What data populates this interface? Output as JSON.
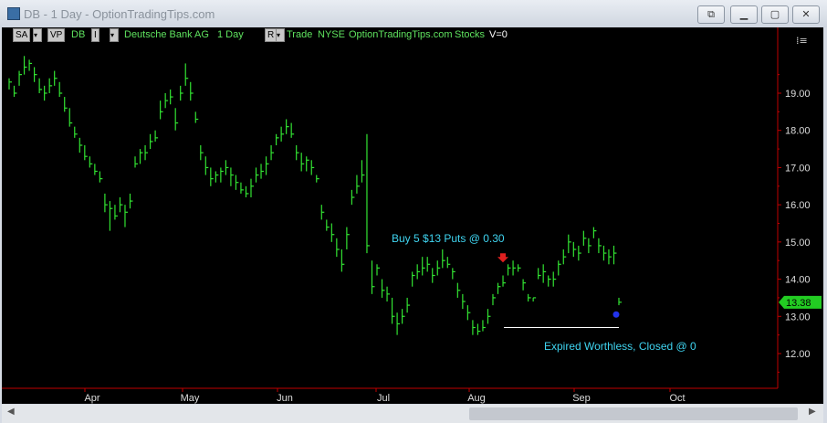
{
  "window": {
    "title": "DB - 1 Day - OptionTradingTips.com"
  },
  "toolbar": {
    "sa_label": "SA",
    "vp_label": "VP",
    "symbol": "DB",
    "i_label": "I",
    "company": "Deutsche Bank AG",
    "period": "1 Day",
    "r_label": "R",
    "trade": "Trade",
    "exchange": "NYSE",
    "site": "OptionTradingTips.com",
    "category": "Stocks",
    "volume": "V=0"
  },
  "colors": {
    "bars": "#32e332",
    "axis": "#c00000",
    "annotation": "#3fd4f0",
    "price_tag": "#22cc22",
    "buy_marker": "#e02020",
    "exit_marker": "#2233ee"
  },
  "chart_data": {
    "type": "ohlc",
    "title": "",
    "xlabel": "",
    "ylabel": "",
    "ylim": [
      11.0,
      20.0
    ],
    "y_ticks": [
      "12.00",
      "13.00",
      "14.00",
      "15.00",
      "16.00",
      "17.00",
      "18.00",
      "19.00"
    ],
    "x_ticks": [
      "Apr",
      "May",
      "Jun",
      "Jul",
      "Aug",
      "Sep",
      "Oct"
    ],
    "last_price": "13.38",
    "annotations": [
      "Buy 5 $13 Puts @ 0.30",
      "Expired Worthless, Closed @ 0"
    ],
    "buy_marker_price": 14.45,
    "exit_marker_price": 13.05,
    "strike_line": 12.7,
    "bars": [
      [
        19.4,
        19.1,
        19.3
      ],
      [
        19.2,
        18.9,
        19.0
      ],
      [
        19.6,
        19.2,
        19.5
      ],
      [
        20.0,
        19.5,
        19.7
      ],
      [
        19.9,
        19.6,
        19.8
      ],
      [
        19.7,
        19.3,
        19.5
      ],
      [
        19.4,
        19.0,
        19.1
      ],
      [
        19.2,
        18.8,
        19.0
      ],
      [
        19.4,
        19.0,
        19.2
      ],
      [
        19.6,
        19.2,
        19.4
      ],
      [
        19.3,
        18.9,
        19.0
      ],
      [
        18.9,
        18.5,
        18.6
      ],
      [
        18.6,
        18.1,
        18.2
      ],
      [
        18.1,
        17.8,
        17.9
      ],
      [
        17.8,
        17.4,
        17.6
      ],
      [
        17.6,
        17.2,
        17.3
      ],
      [
        17.3,
        17.0,
        17.1
      ],
      [
        17.1,
        16.8,
        16.9
      ],
      [
        16.9,
        16.6,
        16.7
      ],
      [
        16.3,
        15.8,
        16.0
      ],
      [
        16.1,
        15.3,
        15.9
      ],
      [
        16.0,
        15.6,
        15.7
      ],
      [
        16.2,
        15.8,
        16.0
      ],
      [
        16.0,
        15.4,
        15.8
      ],
      [
        16.3,
        15.9,
        16.1
      ],
      [
        17.3,
        17.0,
        17.1
      ],
      [
        17.5,
        17.1,
        17.4
      ],
      [
        17.6,
        17.2,
        17.4
      ],
      [
        17.9,
        17.5,
        17.7
      ],
      [
        18.0,
        17.7,
        17.8
      ],
      [
        18.8,
        18.3,
        18.5
      ],
      [
        19.0,
        18.6,
        18.8
      ],
      [
        19.1,
        18.7,
        18.9
      ],
      [
        18.6,
        18.0,
        18.2
      ],
      [
        19.2,
        18.8,
        19.0
      ],
      [
        19.8,
        19.2,
        19.4
      ],
      [
        19.3,
        18.8,
        19.0
      ],
      [
        18.5,
        18.2,
        18.3
      ],
      [
        17.6,
        17.2,
        17.4
      ],
      [
        17.3,
        16.8,
        17.0
      ],
      [
        17.0,
        16.5,
        16.7
      ],
      [
        16.9,
        16.6,
        16.8
      ],
      [
        17.0,
        16.6,
        16.9
      ],
      [
        17.2,
        16.8,
        17.0
      ],
      [
        17.0,
        16.5,
        16.8
      ],
      [
        16.8,
        16.4,
        16.6
      ],
      [
        16.6,
        16.3,
        16.4
      ],
      [
        16.5,
        16.2,
        16.3
      ],
      [
        16.7,
        16.2,
        16.5
      ],
      [
        17.0,
        16.6,
        16.8
      ],
      [
        17.1,
        16.7,
        16.9
      ],
      [
        17.3,
        16.8,
        17.1
      ],
      [
        17.6,
        17.2,
        17.4
      ],
      [
        17.9,
        17.6,
        17.8
      ],
      [
        18.1,
        17.7,
        17.9
      ],
      [
        18.3,
        17.9,
        18.1
      ],
      [
        18.2,
        17.8,
        17.9
      ],
      [
        17.6,
        17.2,
        17.4
      ],
      [
        17.4,
        16.9,
        17.1
      ],
      [
        17.3,
        16.9,
        17.2
      ],
      [
        17.2,
        16.8,
        17.0
      ],
      [
        16.8,
        16.6,
        16.7
      ],
      [
        16.0,
        15.6,
        15.8
      ],
      [
        15.6,
        15.3,
        15.4
      ],
      [
        15.5,
        15.0,
        15.2
      ],
      [
        15.1,
        14.6,
        14.8
      ],
      [
        14.8,
        14.2,
        14.4
      ],
      [
        15.4,
        14.8,
        15.2
      ],
      [
        16.4,
        16.0,
        16.2
      ],
      [
        16.8,
        16.3,
        16.5
      ],
      [
        17.2,
        16.6,
        16.8
      ],
      [
        17.9,
        14.7,
        14.9
      ],
      [
        14.5,
        13.6,
        13.8
      ],
      [
        14.4,
        14.1,
        14.3
      ],
      [
        14.0,
        13.5,
        13.7
      ],
      [
        13.8,
        13.4,
        13.6
      ],
      [
        13.5,
        12.8,
        13.0
      ],
      [
        13.1,
        12.5,
        12.8
      ],
      [
        13.2,
        12.8,
        13.0
      ],
      [
        13.5,
        13.1,
        13.3
      ],
      [
        14.2,
        13.8,
        14.1
      ],
      [
        14.4,
        14.0,
        14.2
      ],
      [
        14.6,
        14.1,
        14.3
      ],
      [
        14.6,
        14.2,
        14.4
      ],
      [
        14.3,
        13.9,
        14.1
      ],
      [
        14.5,
        14.1,
        14.3
      ],
      [
        14.8,
        14.3,
        14.5
      ],
      [
        14.6,
        14.3,
        14.4
      ],
      [
        14.3,
        14.0,
        14.2
      ],
      [
        13.9,
        13.5,
        13.7
      ],
      [
        13.6,
        13.2,
        13.4
      ],
      [
        13.3,
        12.9,
        13.1
      ],
      [
        12.9,
        12.5,
        12.7
      ],
      [
        12.8,
        12.5,
        12.6
      ],
      [
        12.9,
        12.6,
        12.7
      ],
      [
        13.2,
        12.8,
        13.0
      ],
      [
        13.6,
        13.3,
        13.5
      ],
      [
        13.9,
        13.6,
        13.8
      ],
      [
        14.1,
        13.8,
        13.9
      ],
      [
        14.4,
        14.1,
        14.3
      ],
      [
        14.5,
        14.1,
        14.3
      ],
      [
        14.4,
        14.2,
        14.3
      ],
      [
        14.0,
        13.7,
        13.9
      ],
      [
        13.6,
        13.4,
        13.5
      ],
      [
        13.5,
        13.4,
        13.5
      ],
      [
        14.3,
        14.0,
        14.1
      ],
      [
        14.4,
        13.9,
        14.2
      ],
      [
        14.1,
        13.8,
        14.0
      ],
      [
        14.2,
        13.8,
        14.0
      ],
      [
        14.5,
        14.1,
        14.4
      ],
      [
        14.8,
        14.4,
        14.6
      ],
      [
        15.2,
        14.7,
        15.0
      ],
      [
        15.0,
        14.6,
        14.8
      ],
      [
        14.9,
        14.5,
        14.7
      ],
      [
        15.3,
        14.9,
        15.1
      ],
      [
        15.1,
        14.7,
        14.9
      ],
      [
        15.4,
        15.1,
        15.3
      ],
      [
        15.1,
        14.7,
        14.9
      ],
      [
        14.9,
        14.5,
        14.7
      ],
      [
        14.8,
        14.4,
        14.6
      ],
      [
        14.9,
        14.4,
        14.7
      ],
      [
        13.5,
        13.3,
        13.38
      ]
    ]
  }
}
